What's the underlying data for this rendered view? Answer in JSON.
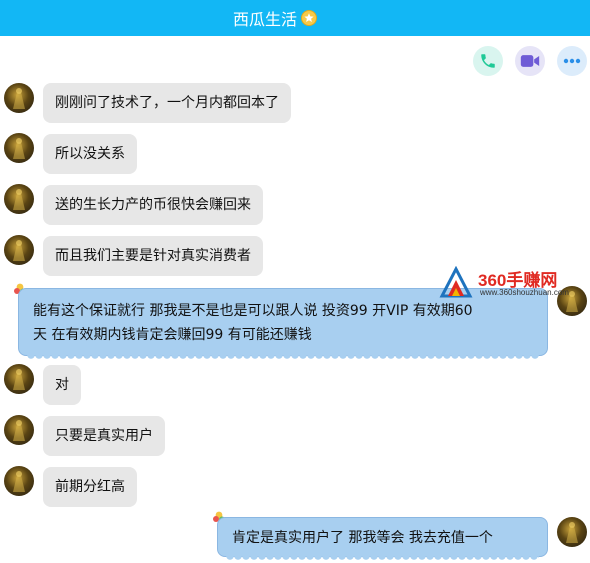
{
  "header": {
    "title": "西瓜生活",
    "badge_icon": "star-badge-icon"
  },
  "actions": [
    {
      "name": "voice-call",
      "icon": "phone-icon",
      "color": "#20c997"
    },
    {
      "name": "video-call",
      "icon": "video-camera-icon",
      "color": "#6f5bd6"
    },
    {
      "name": "more",
      "icon": "more-dots-icon",
      "color": "#2b8fe8"
    }
  ],
  "messages": [
    {
      "side": "left",
      "text": "刚刚问了技术了，一个月内都回本了"
    },
    {
      "side": "left",
      "text": "所以没关系"
    },
    {
      "side": "left",
      "text": "送的生长力产的币很快会赚回来"
    },
    {
      "side": "left",
      "text": "而且我们主要是针对真实消费者"
    },
    {
      "side": "right",
      "lines": [
        "能有这个保证就行 那我是不是也是可以跟人说 投资99 开VIP 有效期60",
        "天 在有效期内钱肯定会赚回99 有可能还赚钱"
      ]
    },
    {
      "side": "left",
      "text": "对"
    },
    {
      "side": "left",
      "text": "只要是真实用户"
    },
    {
      "side": "left",
      "text": "前期分红高"
    },
    {
      "side": "right",
      "lines": [
        "肯定是真实用户了 那我等会 我去充值一个"
      ]
    }
  ],
  "watermark": {
    "name": "360手赚网",
    "url": "www.360shouzhuan.com"
  },
  "colors": {
    "header": "#12b7f5",
    "incoming_bubble": "#e7e7e7",
    "outgoing_bubble": "#a8cff0"
  }
}
